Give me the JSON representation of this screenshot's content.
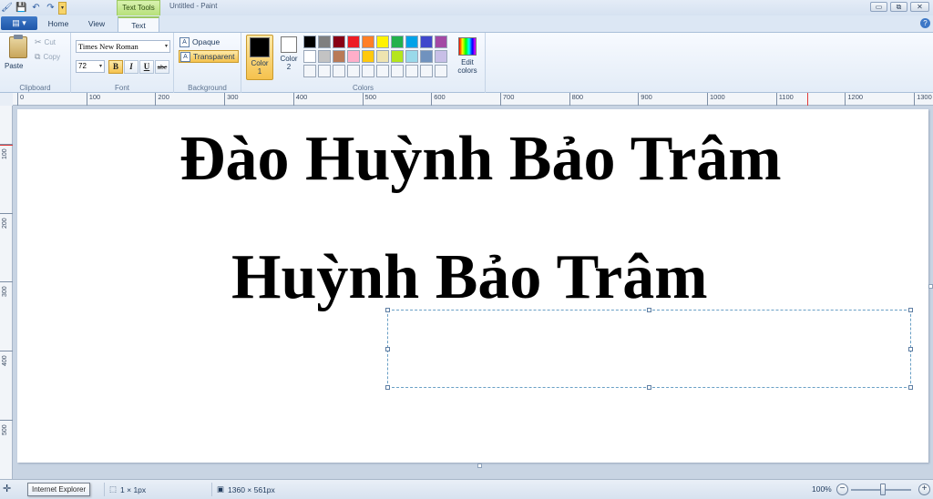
{
  "window": {
    "title": "Untitled - Paint",
    "context_tab": "Text Tools",
    "controls": {
      "minimize": "▭",
      "restore": "⧉",
      "close": "✕"
    }
  },
  "tabs": [
    {
      "label": "Home"
    },
    {
      "label": "View"
    },
    {
      "label": "Text"
    }
  ],
  "ribbon": {
    "clipboard": {
      "label": "Clipboard",
      "paste": "Paste",
      "cut": "Cut",
      "copy": "Copy"
    },
    "font": {
      "label": "Font",
      "family": "Times New Roman",
      "size": "72",
      "bold": "B",
      "italic": "I",
      "underline": "U",
      "strike": "abc"
    },
    "background": {
      "label": "Background",
      "opaque": "Opaque",
      "transparent": "Transparent"
    },
    "colors": {
      "label": "Colors",
      "color1_line1": "Color",
      "color1_line2": "1",
      "color2_line1": "Color",
      "color2_line2": "2",
      "color1": "#000000",
      "color2": "#ffffff",
      "edit_line1": "Edit",
      "edit_line2": "colors",
      "palette": [
        "#000000",
        "#7f7f7f",
        "#880015",
        "#ed1c24",
        "#ff7f27",
        "#fff200",
        "#22b14c",
        "#00a2e8",
        "#3f48cc",
        "#a349a4",
        "#ffffff",
        "#c3c3c3",
        "#b97a57",
        "#ffaec9",
        "#ffc90e",
        "#efe4b0",
        "#b5e61d",
        "#99d9ea",
        "#7092be",
        "#c8bfe7",
        "#ffffff",
        "#ffffff",
        "#ffffff",
        "#ffffff",
        "#ffffff",
        "#ffffff",
        "#ffffff",
        "#ffffff",
        "#ffffff",
        "#ffffff"
      ]
    }
  },
  "rulers": {
    "horizontal": [
      "0",
      "100",
      "200",
      "300",
      "400",
      "500",
      "600",
      "700",
      "800",
      "900",
      "1000",
      "1100",
      "1200",
      "1300"
    ],
    "vertical": [
      "100",
      "200",
      "300",
      "400",
      "500"
    ]
  },
  "canvas": {
    "line1": "Đào Huỳnh Bảo Trâm",
    "line2": "Huỳnh Bảo Trâm"
  },
  "status": {
    "tooltip": "Internet Explorer",
    "selection_size": "1 × 1px",
    "image_size": "1360 × 561px",
    "zoom": "100%"
  }
}
